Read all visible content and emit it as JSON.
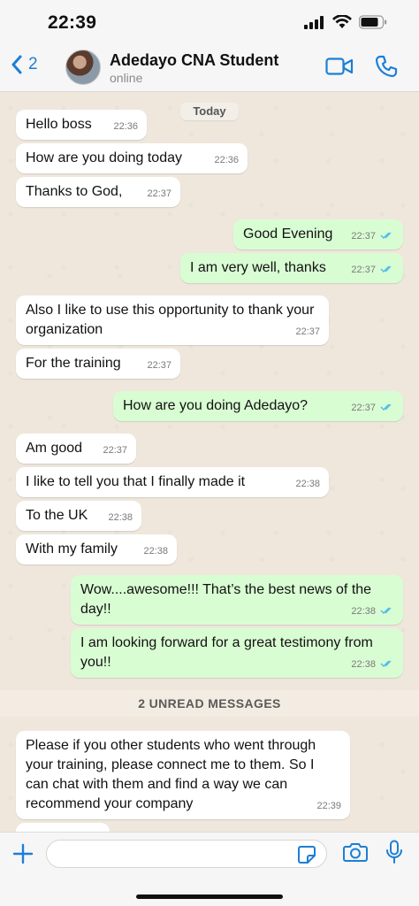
{
  "status_bar": {
    "time": "22:39"
  },
  "header": {
    "back_count": "2",
    "contact_name": "Adedayo CNA Student",
    "contact_status": "online"
  },
  "chat": {
    "date_label": "Today",
    "messages": [
      {
        "dir": "in",
        "text": "Hello boss",
        "time": "22:36"
      },
      {
        "dir": "in",
        "text": "How are you doing today",
        "time": "22:36"
      },
      {
        "dir": "in",
        "text": "Thanks to God,",
        "time": "22:37"
      },
      {
        "dir": "out",
        "text": "Good Evening",
        "time": "22:37"
      },
      {
        "dir": "out",
        "text": "I am very well, thanks",
        "time": "22:37"
      },
      {
        "dir": "in",
        "text": "Also I like to use this opportunity to thank your organization",
        "time": "22:37"
      },
      {
        "dir": "in",
        "text": "For the training",
        "time": "22:37"
      },
      {
        "dir": "out",
        "text": "How are you doing Adedayo?",
        "time": "22:37"
      },
      {
        "dir": "in",
        "text": "Am good",
        "time": "22:37"
      },
      {
        "dir": "in",
        "text": "I like to tell you that I finally made it",
        "time": "22:38"
      },
      {
        "dir": "in",
        "text": "To the UK",
        "time": "22:38"
      },
      {
        "dir": "in",
        "text": "With my family",
        "time": "22:38"
      },
      {
        "dir": "out",
        "text": "Wow....awesome!!! That’s the best news of the day!!",
        "time": "22:38"
      },
      {
        "dir": "out",
        "text": "I am looking forward for a great testimony from you!!",
        "time": "22:38"
      },
      {
        "dir": "in",
        "text": "Please if you other students who went through your training, please connect me to them. So I can chat with them and find a way we can recommend your company",
        "time": "22:39"
      }
    ],
    "unread_banner": "2 UNREAD MESSAGES"
  },
  "colors": {
    "outgoing_bubble": "#d9fdd3",
    "incoming_bubble": "#ffffff",
    "accent": "#1b7fd6",
    "read_ticks": "#53bdeb"
  },
  "icons": [
    "back-chevron-icon",
    "video-call-icon",
    "phone-icon",
    "plus-icon",
    "sticker-icon",
    "camera-icon",
    "microphone-icon"
  ]
}
